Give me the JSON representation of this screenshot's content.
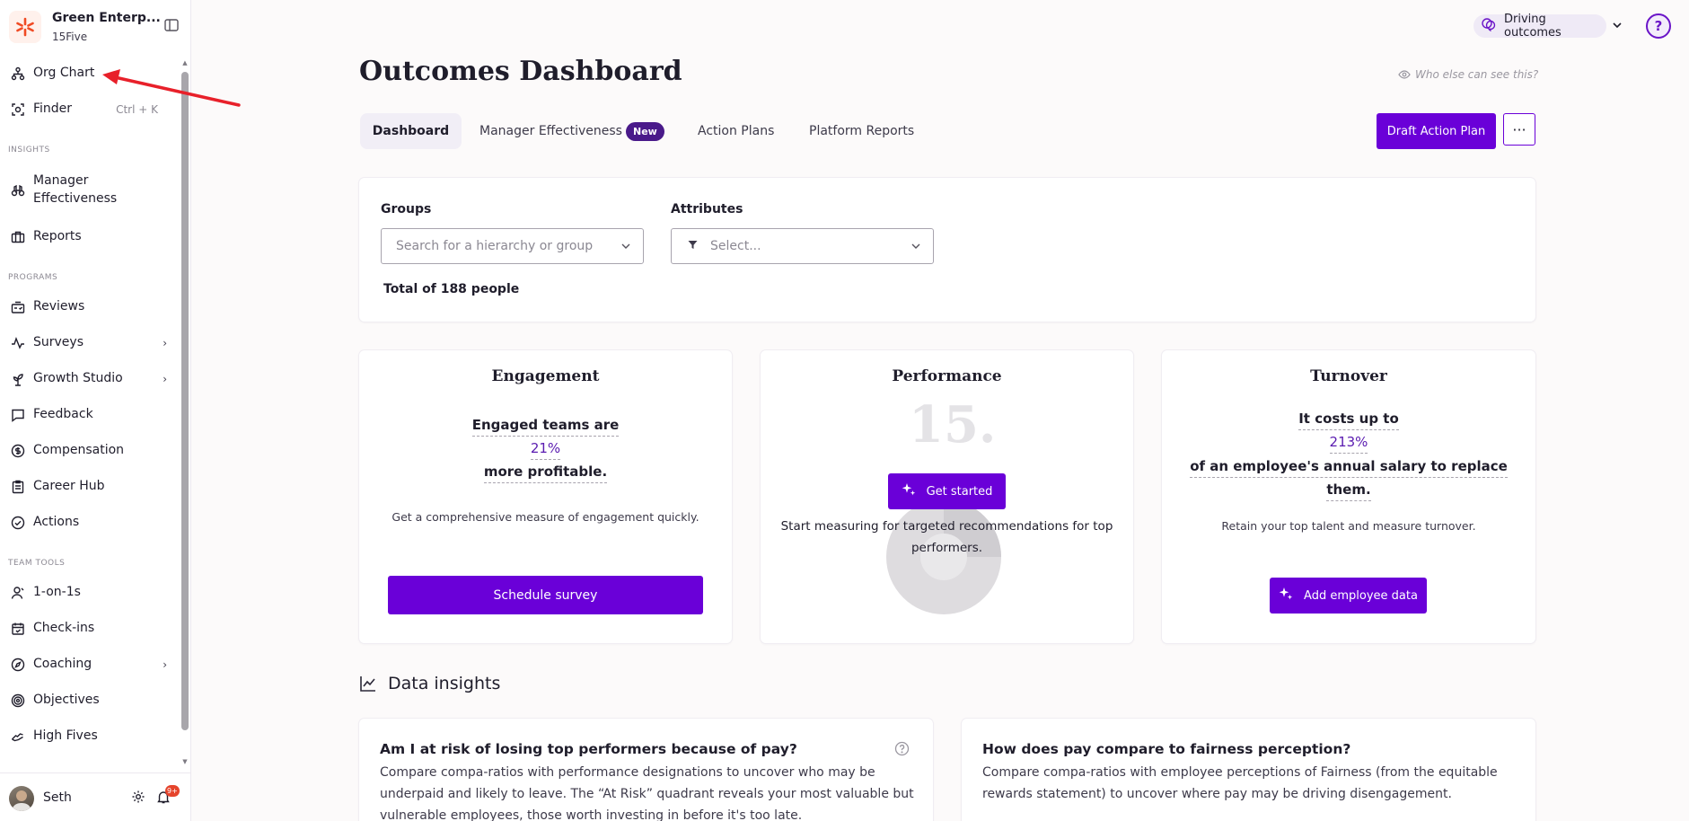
{
  "sidebar": {
    "org_name": "Green Enterp...",
    "org_sub": "15Five",
    "top_items": [
      {
        "label": "Org Chart",
        "icon": "org-chart-icon"
      },
      {
        "label": "Finder",
        "icon": "finder-icon",
        "shortcut": "Ctrl + K"
      }
    ],
    "sections": {
      "insights": "INSIGHTS",
      "programs": "PROGRAMS",
      "team_tools": "TEAM TOOLS"
    },
    "insights_items": [
      {
        "label": "Manager Effectiveness",
        "icon": "binoculars-icon"
      },
      {
        "label": "Reports",
        "icon": "briefcase-icon"
      }
    ],
    "programs_items": [
      {
        "label": "Reviews",
        "icon": "reviews-icon"
      },
      {
        "label": "Surveys",
        "icon": "pulse-icon",
        "has_chevron": true
      },
      {
        "label": "Growth Studio",
        "icon": "growth-icon",
        "has_chevron": true
      },
      {
        "label": "Feedback",
        "icon": "chat-icon"
      },
      {
        "label": "Compensation",
        "icon": "dollar-icon"
      },
      {
        "label": "Career Hub",
        "icon": "clipboard-icon"
      },
      {
        "label": "Actions",
        "icon": "check-circle-icon"
      }
    ],
    "team_items": [
      {
        "label": "1-on-1s",
        "icon": "person-icon"
      },
      {
        "label": "Check-ins",
        "icon": "calendar-icon"
      },
      {
        "label": "Coaching",
        "icon": "compass-icon",
        "has_chevron": true
      },
      {
        "label": "Objectives",
        "icon": "target-icon"
      },
      {
        "label": "High Fives",
        "icon": "high-five-icon"
      }
    ],
    "user": {
      "name": "Seth",
      "notifications": "9+"
    }
  },
  "topbar": {
    "outcome_label": "Driving outcomes",
    "help": "?"
  },
  "header": {
    "title": "Outcomes Dashboard",
    "visibility": "Who else can see this?",
    "tabs": [
      {
        "label": "Dashboard",
        "active": true
      },
      {
        "label": "Manager Effectiveness",
        "badge": "New"
      },
      {
        "label": "Action Plans"
      },
      {
        "label": "Platform Reports"
      }
    ],
    "draft_button": "Draft Action Plan",
    "more_button": "···"
  },
  "filters": {
    "groups_label": "Groups",
    "groups_placeholder": "Search for a hierarchy or group",
    "attributes_label": "Attributes",
    "attributes_placeholder": "Select...",
    "total": "Total of 188 people"
  },
  "metrics": {
    "engagement": {
      "title": "Engagement",
      "line1": "Engaged teams are",
      "value": "21%",
      "line2": "more profitable.",
      "desc": "Get a comprehensive measure of engagement quickly.",
      "button": "Schedule survey"
    },
    "performance": {
      "title": "Performance",
      "watermark": "15.",
      "button": "Get started",
      "desc_line1": "Start measuring for targeted recommendations for top",
      "desc_line2": "performers."
    },
    "turnover": {
      "title": "Turnover",
      "line1": "It costs up to",
      "value": "213%",
      "line2": "of an employee's annual salary to replace",
      "line3": "them.",
      "desc": "Retain your top talent and measure turnover.",
      "button": "Add employee data"
    }
  },
  "insights": {
    "title": "Data insights",
    "cards": [
      {
        "question": "Am I at risk of losing top performers because of pay?",
        "desc_lines": [
          "Compare compa-ratios with performance designations to uncover who may be",
          "underpaid and likely to leave. The “At Risk” quadrant reveals your most valuable but",
          "vulnerable employees, those worth investing in before it's too late."
        ]
      },
      {
        "question": "How does pay compare to fairness perception?",
        "desc_lines": [
          "Compare compa-ratios with employee perceptions of Fairness (from the equitable",
          "rewards statement) to uncover where pay may be driving disengagement."
        ]
      }
    ]
  },
  "colors": {
    "accent": "#6a00d8",
    "brand_orange": "#f04a23",
    "annotation_arrow": "#e8202a"
  }
}
